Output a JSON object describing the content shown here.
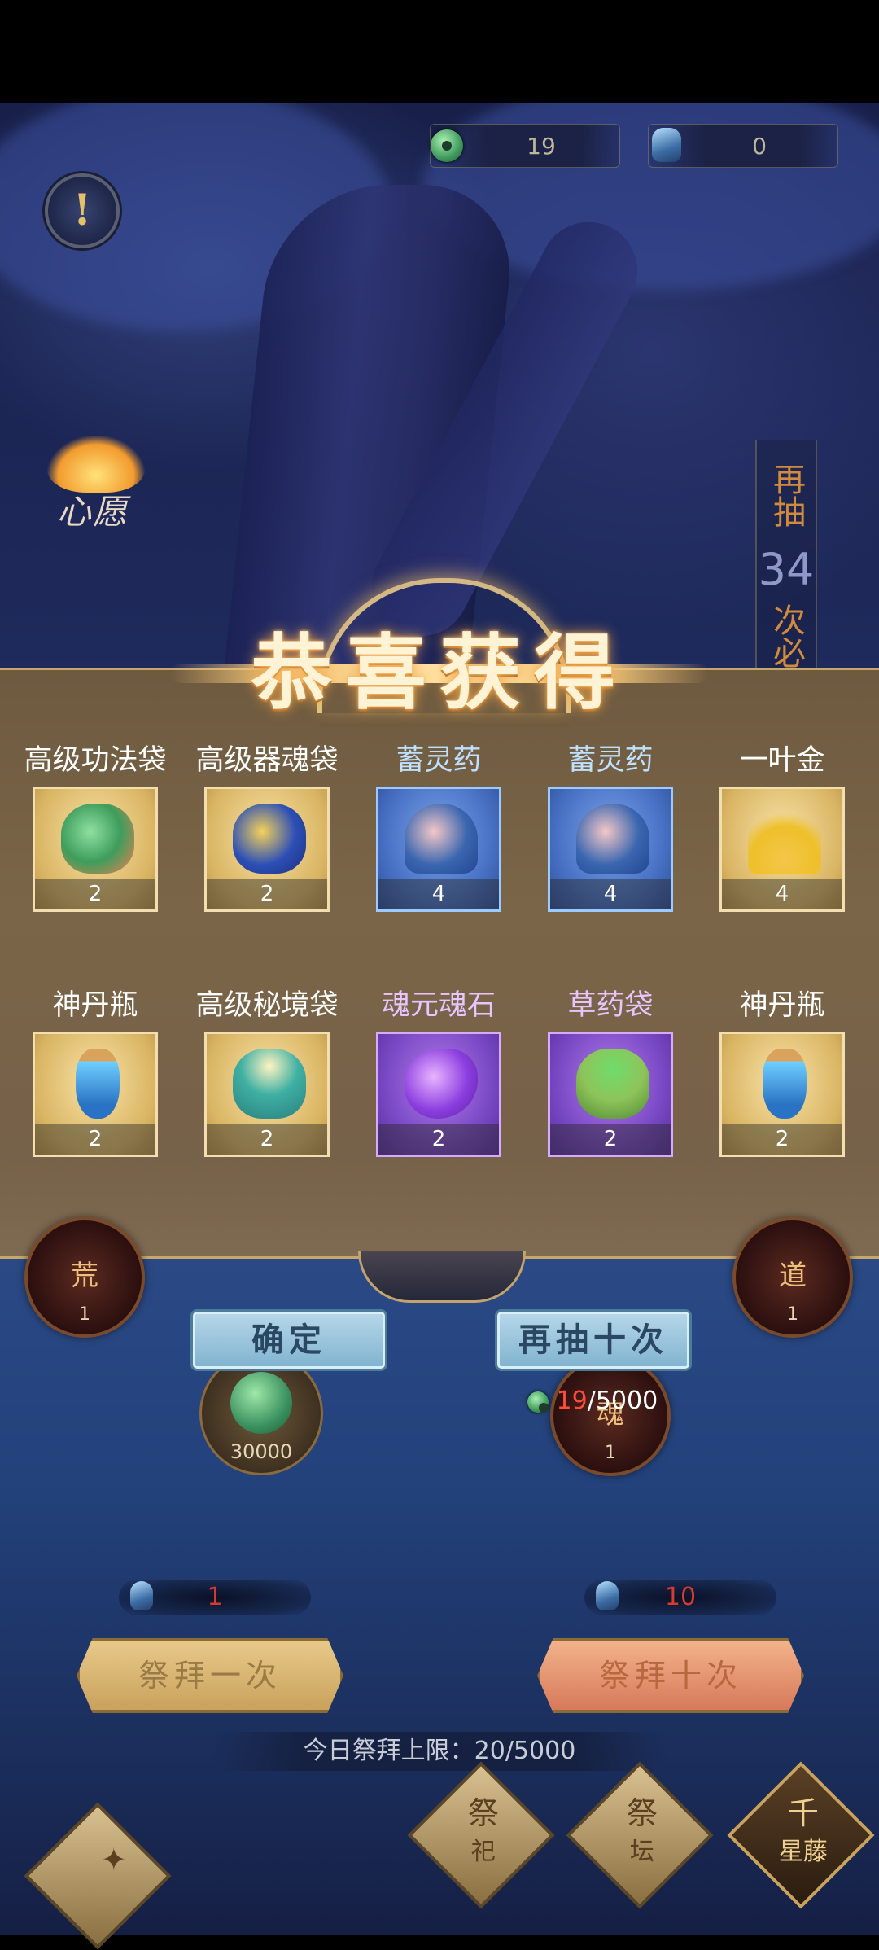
{
  "resources": [
    {
      "icon": "jade-coin-icon",
      "value": "19"
    },
    {
      "icon": "spirit-bottle-icon",
      "value": "0"
    }
  ],
  "info_symbol": "!",
  "wish": {
    "label": "心愿"
  },
  "side_note": {
    "line1": "再抽",
    "number": "34",
    "line2": "次必"
  },
  "dialog": {
    "title": "恭喜获得",
    "items": [
      {
        "name": "高级功法袋",
        "count": "2",
        "rarity": "gold",
        "icon": "technique-bag-icon"
      },
      {
        "name": "高级器魂袋",
        "count": "2",
        "rarity": "gold",
        "icon": "artifact-soul-bag-icon"
      },
      {
        "name": "蓄灵药",
        "count": "4",
        "rarity": "blue",
        "icon": "spirit-potion-icon"
      },
      {
        "name": "蓄灵药",
        "count": "4",
        "rarity": "blue",
        "icon": "spirit-potion-icon"
      },
      {
        "name": "一叶金",
        "count": "4",
        "rarity": "gold",
        "icon": "ginkgo-leaf-icon"
      },
      {
        "name": "神丹瓶",
        "count": "2",
        "rarity": "gold",
        "icon": "elixir-flask-icon"
      },
      {
        "name": "高级秘境袋",
        "count": "2",
        "rarity": "gold",
        "icon": "realm-bag-icon"
      },
      {
        "name": "魂元魂石",
        "count": "2",
        "rarity": "purple",
        "icon": "soul-stone-icon"
      },
      {
        "name": "草药袋",
        "count": "2",
        "rarity": "purple",
        "icon": "herb-bag-icon"
      },
      {
        "name": "神丹瓶",
        "count": "2",
        "rarity": "gold",
        "icon": "elixir-flask-icon"
      }
    ]
  },
  "orbs": {
    "left": {
      "label": "荒",
      "num": "1"
    },
    "right": {
      "label": "道",
      "num": "1"
    },
    "soul": {
      "label": "魂",
      "num": "1"
    }
  },
  "jade_orb": {
    "num": "30000"
  },
  "confirm_label": "确定",
  "redraw_label": "再抽十次",
  "cost": {
    "have": "19",
    "need": "/5000"
  },
  "worship": {
    "once": {
      "cost": "1",
      "label": "祭拜一次"
    },
    "ten": {
      "cost": "10",
      "label": "祭拜十次"
    }
  },
  "daily_limit": "今日祭拜上限：20/5000",
  "nav": [
    {
      "label": "祭",
      "sub": "祀"
    },
    {
      "label": "祭",
      "sub": "坛"
    },
    {
      "label": "千",
      "sub": "星藤"
    }
  ],
  "colors": {
    "accent_gold": "#f3deb0",
    "cost_red": "#ff4b3a",
    "dialog_bg": "#75604a"
  }
}
